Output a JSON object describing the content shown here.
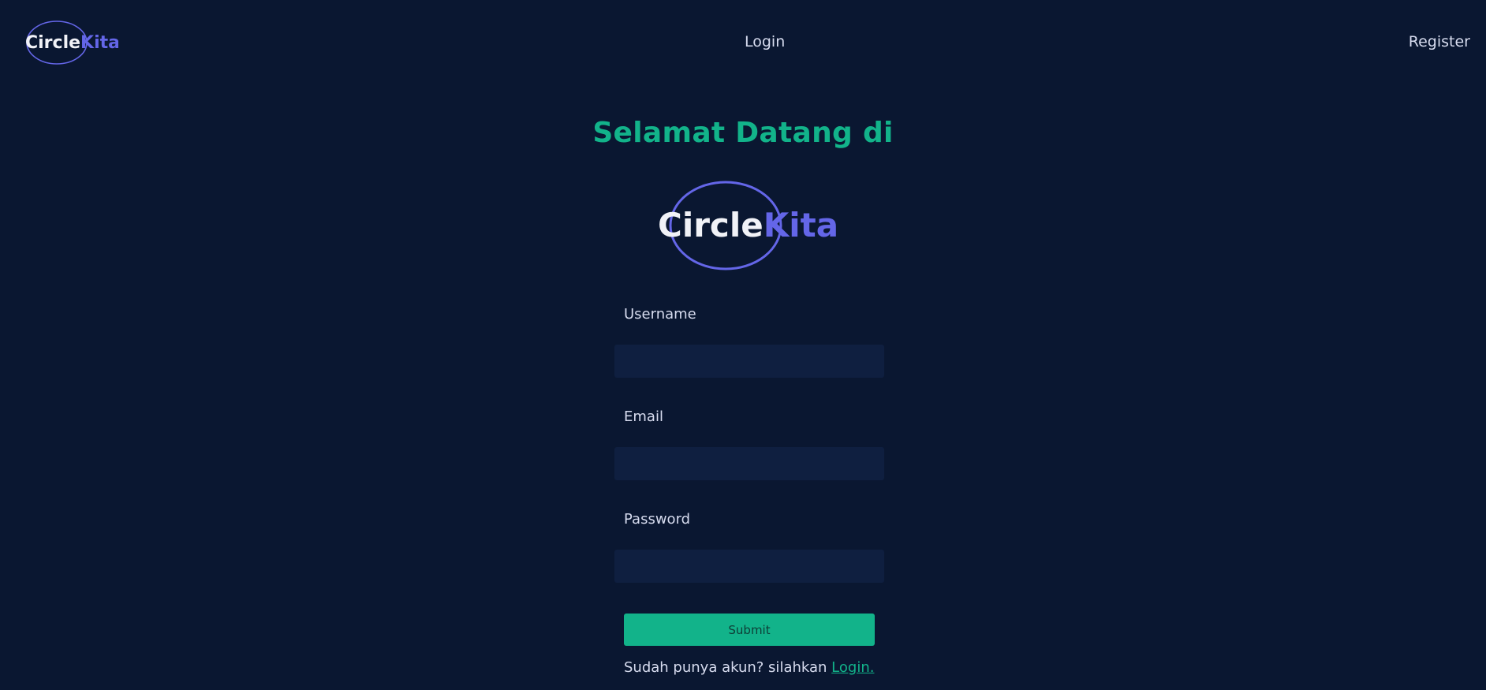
{
  "brand": {
    "name_part1": "Circle",
    "name_part2": "Kita",
    "primary_color": "#6466e8",
    "accent_color": "#12b38a",
    "background_color": "#0a1731",
    "input_background": "#0f1f40"
  },
  "nav": {
    "login_label": "Login",
    "register_label": "Register"
  },
  "main": {
    "welcome_title": "Selamat Datang di"
  },
  "form": {
    "username_label": "Username",
    "username_value": "",
    "email_label": "Email",
    "email_value": "",
    "password_label": "Password",
    "password_value": "",
    "submit_label": "Submit"
  },
  "footer": {
    "prompt_text": "Sudah punya akun? silahkan",
    "login_link_label": "Login."
  }
}
